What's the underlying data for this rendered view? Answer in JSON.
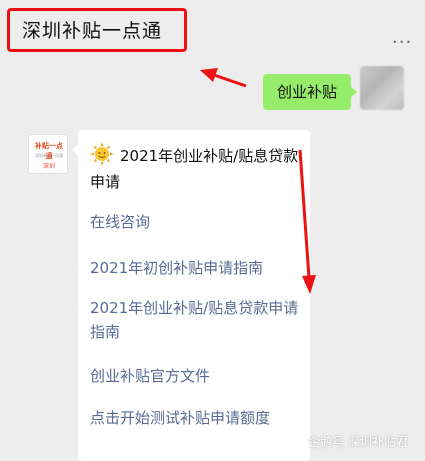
{
  "header": {
    "title": "深圳补贴一点通",
    "more_glyph": "..."
  },
  "messages": {
    "sent": {
      "text": "创业补贴"
    },
    "received": {
      "avatar_logo": {
        "line1": "补贴一点通",
        "line2": "深圳补贴一点通",
        "line3": "深圳"
      },
      "headline_emoji": "sun-icon",
      "headline": "2021年创业补贴/贴息贷款申请",
      "links": [
        "在线咨询",
        "2021年初创补贴申请指南",
        "2021年创业补贴/贴息贷款申请指南",
        "创业补贴官方文件",
        "点击开始测试补贴申请额度"
      ]
    }
  },
  "watermark": {
    "text": "企鹅号 深圳补贴君"
  },
  "colors": {
    "annotation_red": "#ee1111",
    "sent_bubble": "#95ec69",
    "link": "#576b95",
    "background": "#ededed"
  }
}
